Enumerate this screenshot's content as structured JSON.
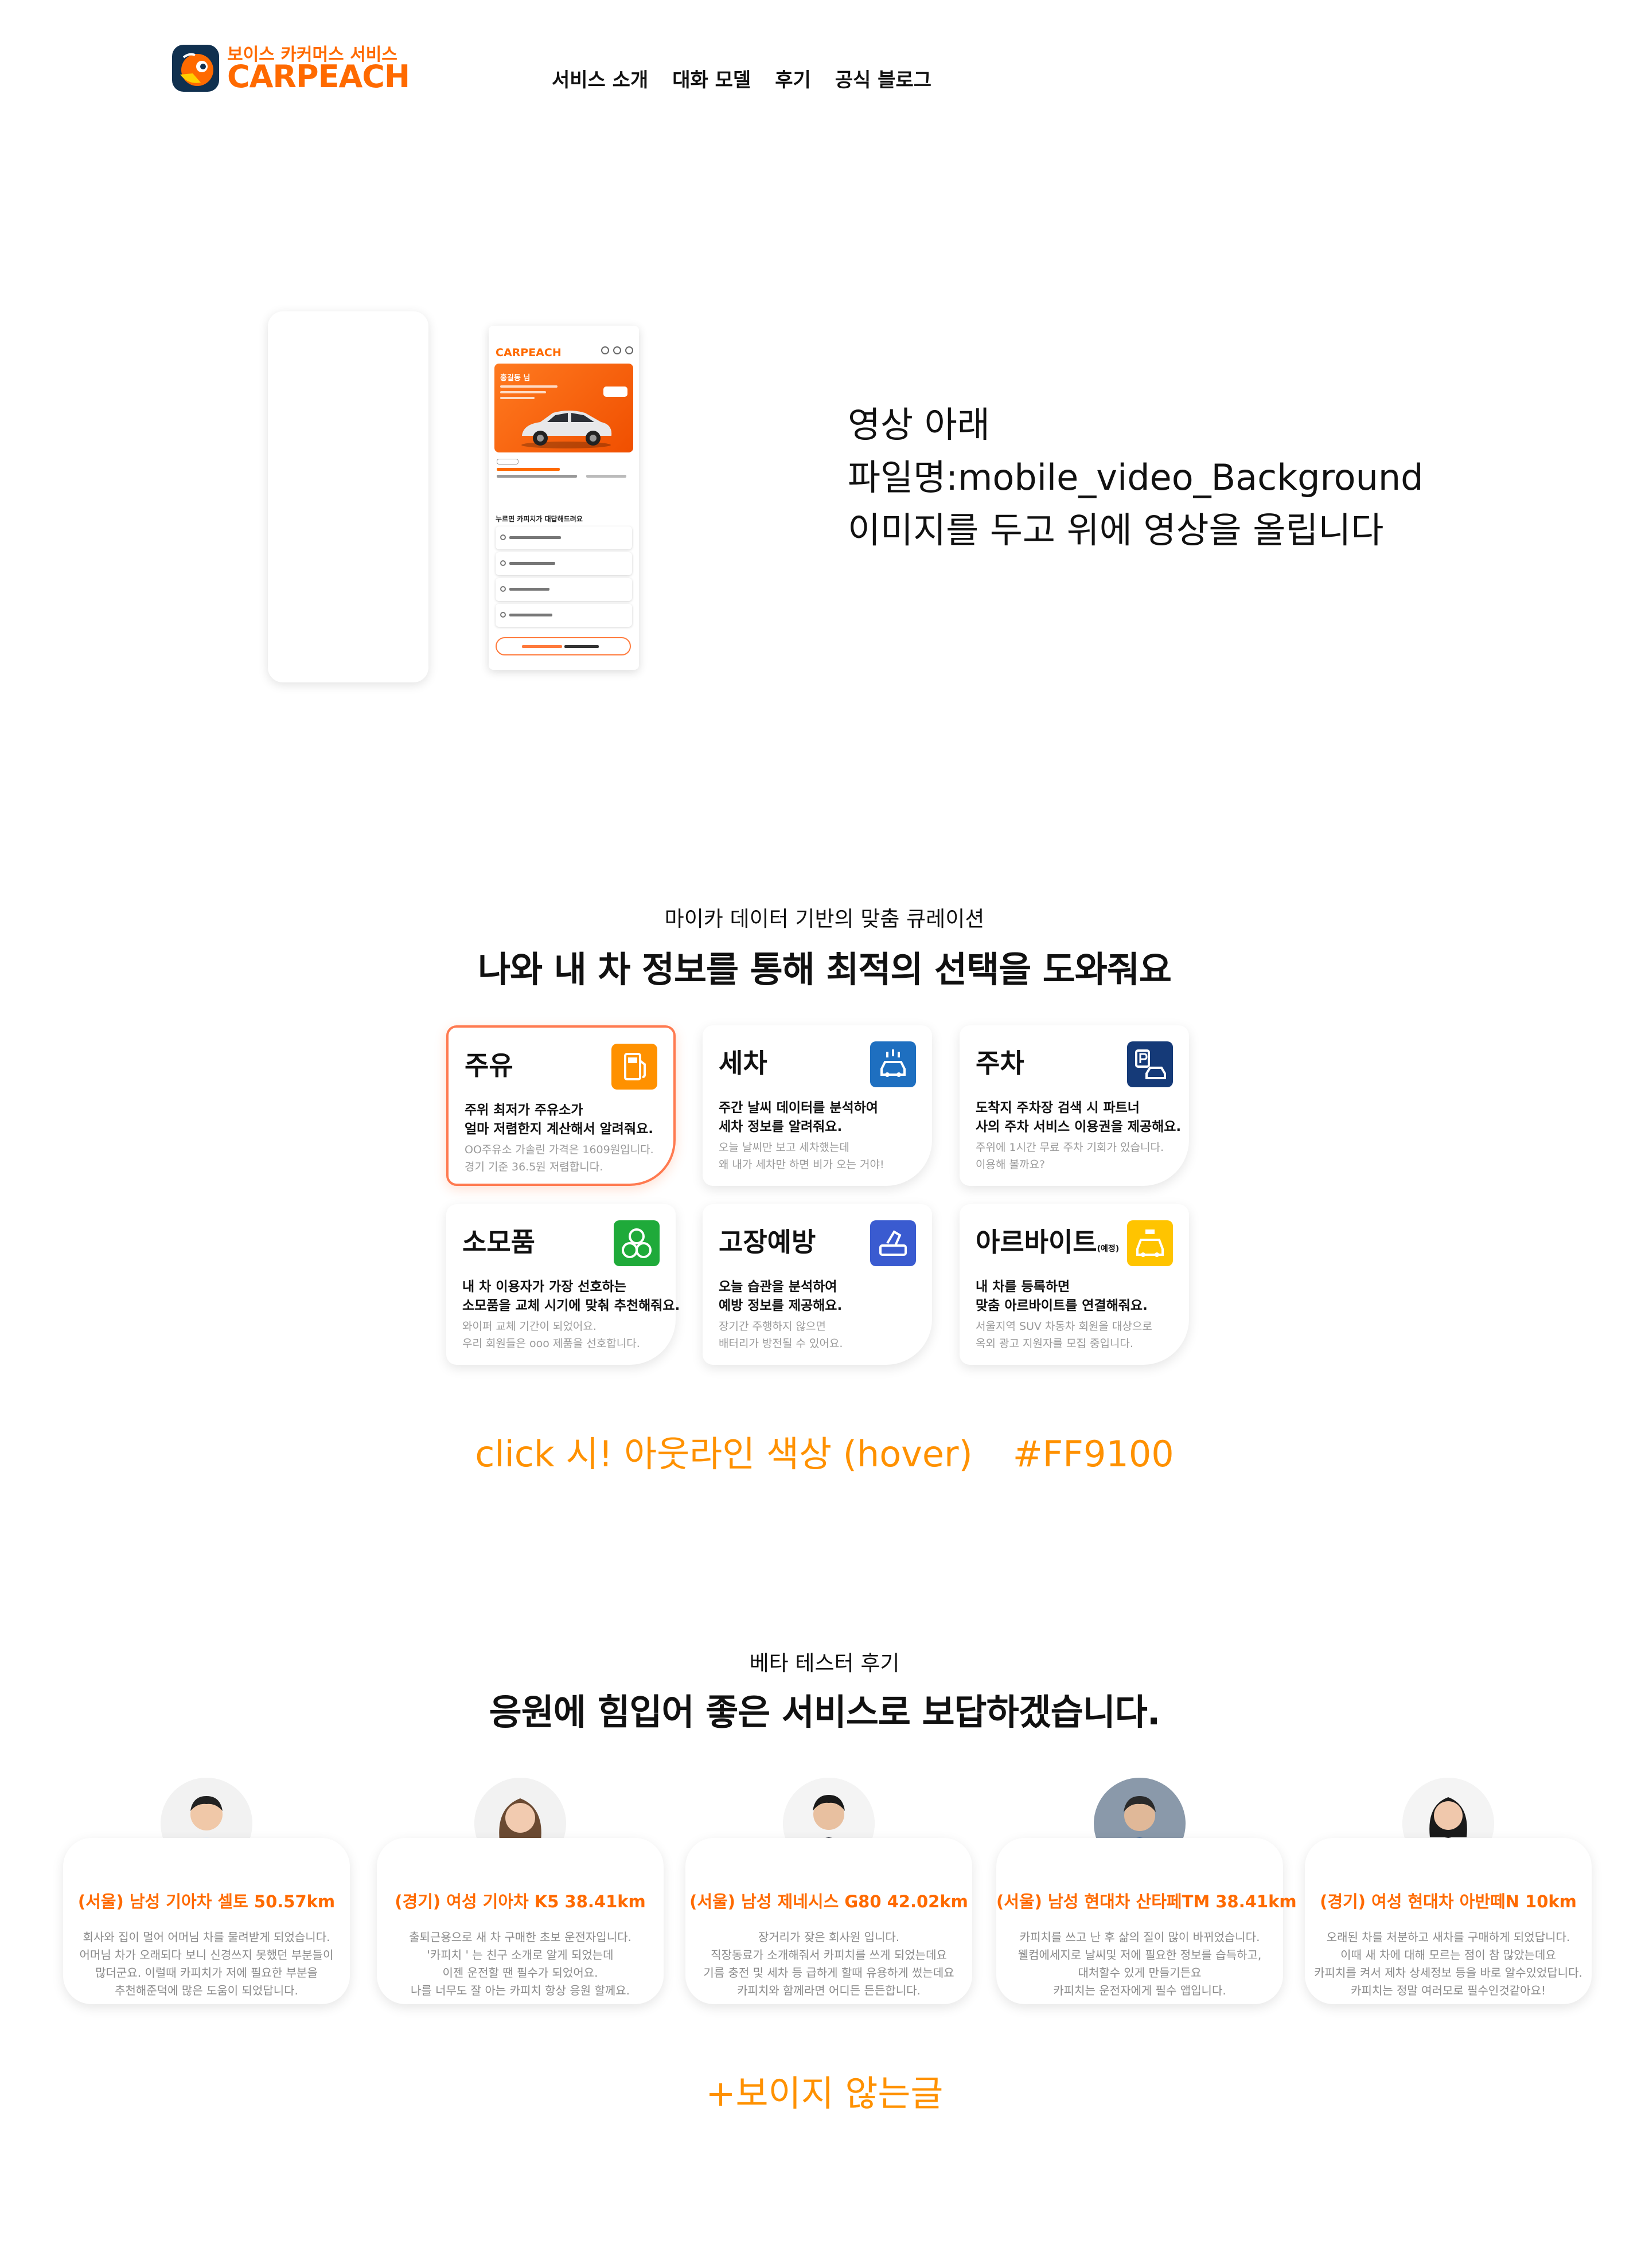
{
  "header": {
    "logo_sub": "보이스 카커머스 서비스",
    "logo_main": "CARPEACH",
    "nav": [
      "서비스 소개",
      "대화 모델",
      "후기",
      "공식 블로그"
    ]
  },
  "hero": {
    "app_logo": "CARPEACH",
    "app_greeting": "홍길동 님",
    "app_menu_title": "누르면 카피치가 대답해드려요",
    "note_lines": [
      "영상 아래",
      "파일명:mobile_video_Background",
      "이미지를 두고 위에 영상을 올립니다"
    ]
  },
  "curation": {
    "subtitle": "마이카 데이터 기반의 맞춤 큐레이션",
    "title": "나와 내 차 정보를 통해 최적의 선택을 도와줘요",
    "cards": [
      {
        "title": "주유",
        "desc": [
          "주위 최저가 주유소가",
          "얼마 저렴한지 계산해서 알려줘요."
        ],
        "note": [
          "OO주유소 가솔린 가격은 1609원입니다.",
          "경기 기준 36.5원 저렴합니다."
        ],
        "icon": "fuel-icon",
        "color": "#ff9100"
      },
      {
        "title": "세차",
        "desc": [
          "주간 날씨 데이터를 분석하여",
          "세차 정보를 알려줘요."
        ],
        "note": [
          "오늘 날씨만 보고 세차했는데",
          "왜 내가 세차만 하면 비가 오는 거야!"
        ],
        "icon": "car-wash-icon",
        "color": "#1e6fc0"
      },
      {
        "title": "주차",
        "desc": [
          "도착지 주차장 검색 시 파트너",
          "사의 주차 서비스 이용권을 제공해요."
        ],
        "note": [
          "주위에 1시간 무료 주차 기회가 있습니다.",
          "이용해 볼까요?"
        ],
        "icon": "parking-icon",
        "color": "#153a78"
      },
      {
        "title": "소모품",
        "desc": [
          "내 차 이용자가 가장 선호하는",
          "소모품을 교체 시기에 맞춰 추천해줘요."
        ],
        "note": [
          "와이퍼 교체 기간이 되었어요.",
          "우리 회원들은 ooo 제품을 선호합니다."
        ],
        "icon": "parts-icon",
        "color": "#1faa3a"
      },
      {
        "title": "고장예방",
        "desc": [
          "오늘 습관을 분석하여",
          "예방 정보를 제공해요."
        ],
        "note": [
          "장기간 주행하지 않으면",
          "배터리가 방전될 수 있어요."
        ],
        "icon": "repair-icon",
        "color": "#3a5bd0"
      },
      {
        "title": "아르바이트",
        "title_suffix": "(예정)",
        "desc": [
          "내 차를 등록하면",
          "맞춤 아르바이트를 연결해줘요."
        ],
        "note": [
          "서울지역 SUV 차동차 회원을 대상으로",
          "옥외 광고 지원자를 모집 중입니다."
        ],
        "icon": "taxi-icon",
        "color": "#ffc400"
      }
    ],
    "hover_note": {
      "text": "click 시!  아웃라인 색상 (hover)",
      "code": "#FF9100"
    }
  },
  "reviews": {
    "subtitle": "베타 테스터 후기",
    "title": "응원에 힘입어 좋은 서비스로 보답하겠습니다.",
    "items": [
      {
        "title": "(서울) 남성 기아차 셀토  50.57km",
        "body": [
          "회사와 집이 멀어 어머님 차를 물려받게 되었습니다.",
          "어머님 차가 오래되다 보니 신경쓰지 못했던 부분들이",
          "많더군요. 이럴때 카피치가 저에 필요한 부분을",
          "추천해준덕에 많은 도움이 되었답니다."
        ],
        "avatar": "male-office-avatar"
      },
      {
        "title": "(경기) 여성 기아차 K5  38.41km",
        "body": [
          "출퇴근용으로 새 차 구매한 초보 운전자입니다.",
          "'카피치 ' 는 친구 소개로 알게 되었는데",
          "이젠 운전할 땐 필수가 되었어요.",
          "나를 너무도 잘 아는 카피치 항상 응원 할께요."
        ],
        "avatar": "female-smile-avatar"
      },
      {
        "title": "(서울) 남성 제네시스 G80  42.02km",
        "body": [
          "장거리가 잦은 회사원 입니다.",
          "직장동료가 소개해줘서 카피치를 쓰게 되었는데요",
          "기름 충전 및 세차 등 급하게 할때 유용하게 썼는데요",
          "카피치와 함께라면 어디든 든든합니다."
        ],
        "avatar": "male-suit-avatar"
      },
      {
        "title": "(서울) 남성 현대차 산타페TM 38.41km",
        "body": [
          "카피치를 쓰고 난 후 삶의 질이 많이 바뀌었습니다.",
          "웰컴에세지로 날씨및 저에 필요한 정보를 습득하고,",
          "대처할수 있게 만들기든요",
          "카피치는 운전자에게 필수 앱입니다."
        ],
        "avatar": "male-casual-avatar"
      },
      {
        "title": "(경기) 여성  현대차 아반떼N  10km",
        "body": [
          "오래된 차를 처분하고 새차를 구매하게 되었답니다.",
          "이때 새 차에 대해 모르는 점이 참 많았는데요",
          "카피치를 켜서 제차 상세정보 등을 바로 알수있었답니다.",
          "카피치는 정말 여러모로 필수인것같아요!"
        ],
        "avatar": "female-business-avatar"
      }
    ],
    "more_note": "+보이지 않는글"
  }
}
